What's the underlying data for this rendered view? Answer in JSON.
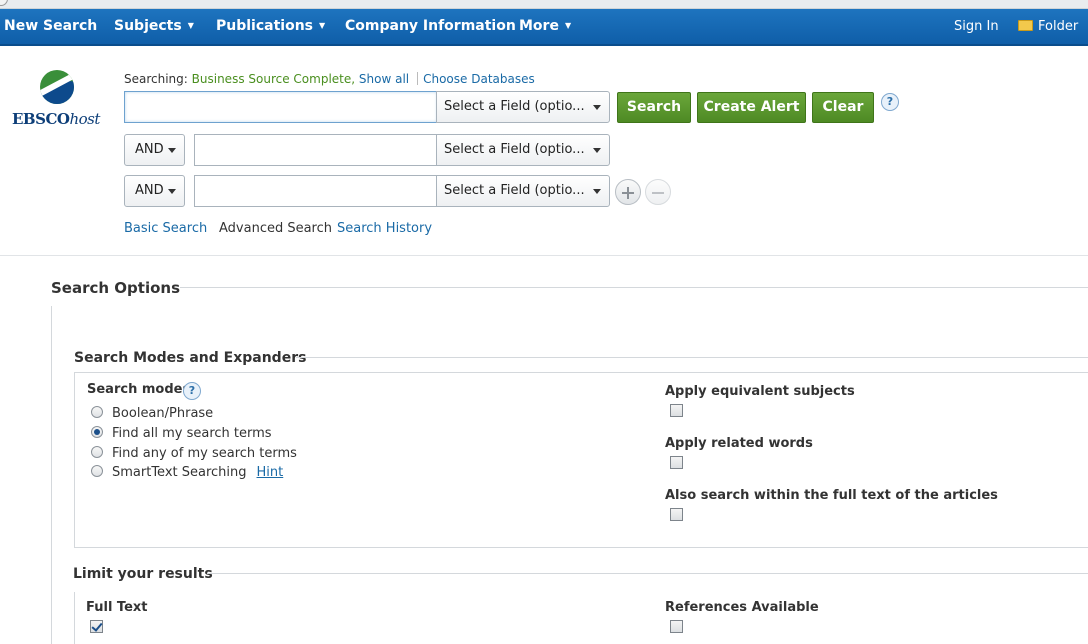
{
  "nav": {
    "new_search": "New Search",
    "subjects": "Subjects",
    "publications": "Publications",
    "company_information": "Company Information",
    "more": "More",
    "sign_in": "Sign In",
    "folder": "Folder"
  },
  "logo": {
    "brand": "EBSCO",
    "suffix": "host"
  },
  "searching": {
    "prefix": "Searching:",
    "database": "Business Source Complete,",
    "show_all": "Show all",
    "choose_databases": "Choose Databases"
  },
  "search_rows": [
    {
      "value": "",
      "field": "Select a Field (optio..."
    },
    {
      "operator": "AND",
      "value": "",
      "field": "Select a Field (optio..."
    },
    {
      "operator": "AND",
      "value": "",
      "field": "Select a Field (optio..."
    }
  ],
  "buttons": {
    "search": "Search",
    "create_alert": "Create Alert",
    "clear": "Clear",
    "help": "?"
  },
  "tabs": {
    "basic": "Basic Search",
    "advanced": "Advanced Search",
    "history": "Search History"
  },
  "options": {
    "title": "Search Options",
    "modes_section": "Search Modes and Expanders",
    "modes_label": "Search modes",
    "modes_help": "?",
    "modes": [
      {
        "label": "Boolean/Phrase",
        "selected": false
      },
      {
        "label": "Find all my search terms",
        "selected": true
      },
      {
        "label": "Find any of my search terms",
        "selected": false
      },
      {
        "label": "SmartText Searching",
        "selected": false
      }
    ],
    "hint": "Hint",
    "expanders": [
      {
        "label": "Apply equivalent subjects",
        "checked": false
      },
      {
        "label": "Apply related words",
        "checked": false
      },
      {
        "label": "Also search within the full text of the articles",
        "checked": false
      }
    ],
    "limit_section": "Limit your results",
    "limits": [
      {
        "label": "Full Text",
        "checked": true
      },
      {
        "label": "References Available",
        "checked": false
      }
    ]
  }
}
